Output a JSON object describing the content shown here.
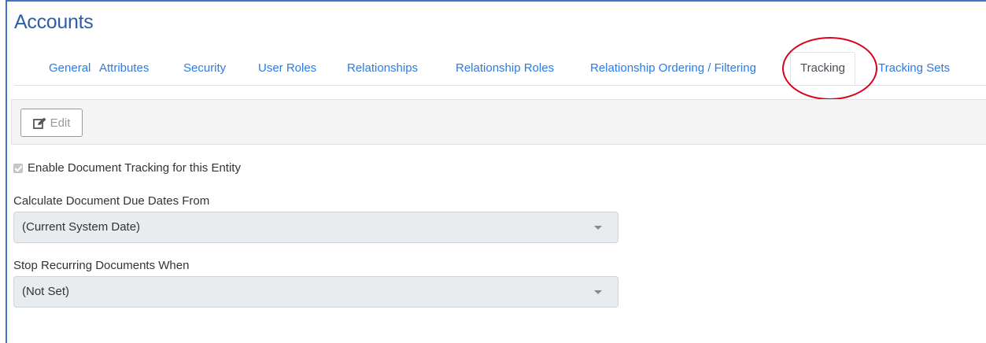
{
  "page": {
    "title": "Accounts"
  },
  "tabs": [
    {
      "label": "General"
    },
    {
      "label": "Attributes"
    },
    {
      "label": "Security"
    },
    {
      "label": "User Roles"
    },
    {
      "label": "Relationships"
    },
    {
      "label": "Relationship Roles"
    },
    {
      "label": "Relationship Ordering / Filtering"
    },
    {
      "label": "Tracking",
      "active": true
    },
    {
      "label": "Tracking Sets"
    }
  ],
  "toolbar": {
    "edit_label": "Edit",
    "edit_icon": "edit-icon"
  },
  "form": {
    "enable_tracking": {
      "label": "Enable Document Tracking for this Entity",
      "checked": true,
      "disabled": true
    },
    "due_dates": {
      "label": "Calculate Document Due Dates From",
      "value": "(Current System Date)"
    },
    "stop_recurring": {
      "label": "Stop Recurring Documents When",
      "value": "(Not Set)"
    }
  },
  "colors": {
    "title": "#2c5fa8",
    "tab_link": "#2c7be5",
    "highlight": "#d9001b",
    "frame": "#4472c4"
  }
}
